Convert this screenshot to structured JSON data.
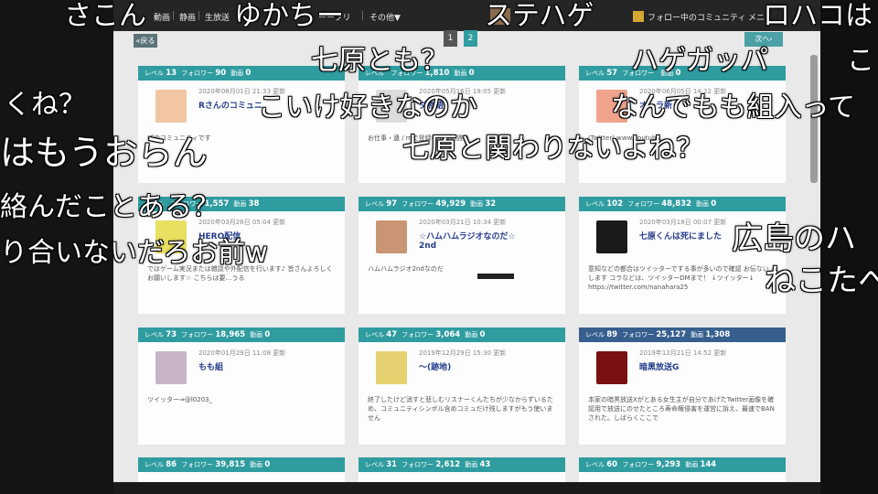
{
  "navbar": {
    "items": [
      "動画",
      "静画",
      "生放送",
      "ーーブリ",
      "その他▼"
    ],
    "right_community": "フォロー中のコミュニティ",
    "right_menu": "メニ"
  },
  "pagination": {
    "back": "«戻る",
    "page1": "1",
    "page2": "2",
    "next": "次へ›"
  },
  "cards": [
    {
      "level": "13",
      "followers": "90",
      "videos": "0",
      "date": "2020年08月01日 21:33 更新",
      "title": "Rさんのコミュニ",
      "desc": "ぽのコミュニティです",
      "avatar_color": "#f2c5a3",
      "theme": "teal"
    },
    {
      "level": "",
      "followers": "1,810",
      "videos": "0",
      "date": "2020年05月16日 19:05 更新",
      "title": "ダ物語",
      "desc": "お仕事・遺 / mで登録者 / り出遅れ",
      "avatar_color": "#dddddd",
      "theme": "teal"
    },
    {
      "level": "57",
      "followers": "",
      "videos": "0",
      "date": "2020年06月05日 14:22 更新",
      "title": "オーラ新",
      "desc": "(Twitter)    www.youtube",
      "avatar_color": "#f0a48c",
      "theme": "teal"
    },
    {
      "level": "",
      "followers": "1,557",
      "videos": "38",
      "date": "2020年03月26日 05:04 更新",
      "title": "HERO配信",
      "desc": "ではゲーム実況または雑談や外配信を行います♪ 皆さんよろしくお願いします☆ こちらは要…うる",
      "avatar_color": "#e8e060",
      "theme": "teal"
    },
    {
      "level": "97",
      "followers": "49,929",
      "videos": "32",
      "date": "2020年03月21日 10:34 更新",
      "title": "☆ハムハムラジオなのだ☆",
      "title2": "2nd",
      "desc": "ハムハムラジオ2ndなのだ",
      "avatar_color": "#c99572",
      "theme": "teal"
    },
    {
      "level": "102",
      "followers": "48,832",
      "videos": "0",
      "date": "2020年03月18日 00:07 更新",
      "title": "七原くんは死にました",
      "desc": "意知などの都合はツイッターでする事が多いので確認 お伝ないします コラなどは、ツイッターDMまで！ ↓ツイッター↓ https://twitter.com/nanahara25",
      "avatar_color": "#1a1a1a",
      "theme": "teal"
    },
    {
      "level": "73",
      "followers": "18,965",
      "videos": "0",
      "date": "2020年01月29日 11:08 更新",
      "title": "もも組",
      "desc": "ツイッター⇒@l0203_",
      "avatar_color": "#c8b4c8",
      "theme": "teal"
    },
    {
      "level": "47",
      "followers": "3,064",
      "videos": "0",
      "date": "2019年12月29日 15:30 更新",
      "title": "～(跡地)",
      "desc": "終了したけど消すと悲しむリスナーくんたちが少なからずいるため、コミュニティシンボル含めコミュだけ残しますがもう使いません",
      "avatar_color": "#e6d070",
      "theme": "teal"
    },
    {
      "level": "89",
      "followers": "25,127",
      "videos": "1,308",
      "date": "2019年12月21日 14:52 更新",
      "title": "暗黒放送G",
      "desc": "本家の暗黒放送Xがとある女生主が自分であげたTwitter画像を確認用で放送にのせたところ寿命権侵害を運営に訴え、最速でBANされた。しばらくここで",
      "avatar_color": "#7a1010",
      "theme": "blue"
    },
    {
      "level": "86",
      "followers": "39,815",
      "videos": "0",
      "theme": "teal"
    },
    {
      "level": "31",
      "followers": "2,612",
      "videos": "43",
      "theme": "teal"
    },
    {
      "level": "60",
      "followers": "9,293",
      "videos": "144",
      "theme": "teal"
    }
  ],
  "labels": {
    "level": "レベル",
    "followers": "フォロワー",
    "videos": "動画"
  },
  "comments": [
    {
      "text": "さこん",
      "size": 30
    },
    {
      "text": "ゆかちー",
      "size": 30
    },
    {
      "text": "ステハゲ",
      "size": 30
    },
    {
      "text": "ロハコは",
      "size": 30
    },
    {
      "text": "七原とも？",
      "size": 30
    },
    {
      "text": "ハゲガッパ",
      "size": 30
    },
    {
      "text": "こ",
      "size": 30
    },
    {
      "text": "こいけ好きなのか",
      "size": 30
    },
    {
      "text": "なんでもも組入って",
      "size": 30
    },
    {
      "text": "くね？",
      "size": 30
    },
    {
      "text": "はもうおらん",
      "size": 38
    },
    {
      "text": "七原と関わりないよね？",
      "size": 30
    },
    {
      "text": "絡んだことある？",
      "size": 30
    },
    {
      "text": "広島のハ",
      "size": 34
    },
    {
      "text": "り合いないだろお前w",
      "size": 30
    },
    {
      "text": "ねこたへ",
      "size": 34
    }
  ]
}
